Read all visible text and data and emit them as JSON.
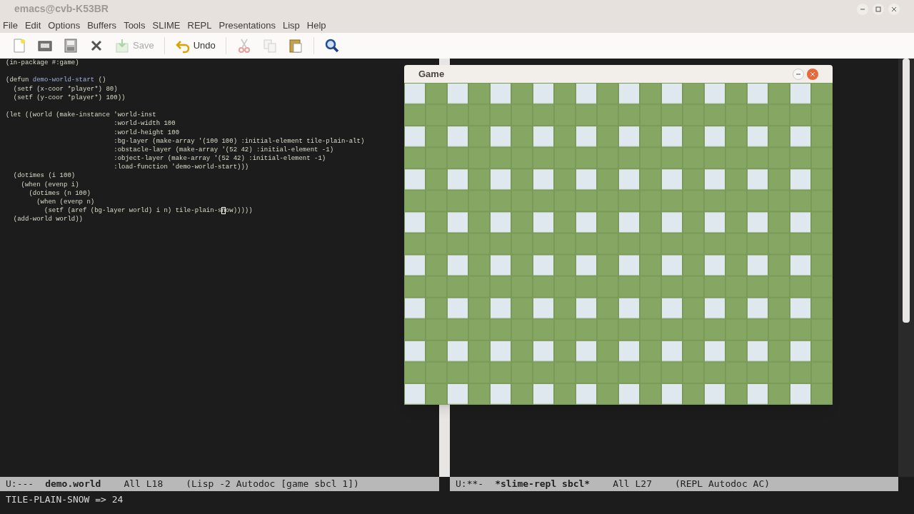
{
  "window": {
    "title": "emacs@cvb-K53BR"
  },
  "menu": [
    "File",
    "Edit",
    "Options",
    "Buffers",
    "Tools",
    "SLIME",
    "REPL",
    "Presentations",
    "Lisp",
    "Help"
  ],
  "toolbar": [
    {
      "kind": "new-file",
      "disabled": false
    },
    {
      "kind": "open-folder",
      "disabled": false
    },
    {
      "kind": "save-disk",
      "disabled": false
    },
    {
      "kind": "close",
      "disabled": false
    },
    {
      "kind": "save",
      "label": "Save",
      "disabled": true
    },
    {
      "kind": "separator"
    },
    {
      "kind": "undo",
      "label": "Undo",
      "disabled": false
    },
    {
      "kind": "separator"
    },
    {
      "kind": "cut",
      "disabled": true
    },
    {
      "kind": "copy",
      "disabled": true
    },
    {
      "kind": "paste",
      "disabled": false
    },
    {
      "kind": "separator"
    },
    {
      "kind": "search",
      "disabled": false
    }
  ],
  "editor": {
    "blocks": [
      [
        [
          {
            "kind": "plain",
            "text": "(in-package #:game)"
          }
        ]
      ],
      [
        [
          {
            "kind": "plain",
            "text": "(defun "
          },
          {
            "kind": "function-name",
            "text": "demo-world-start"
          },
          {
            "kind": "plain",
            "text": " ()"
          }
        ],
        [
          {
            "kind": "plain",
            "text": "  (setf (x-coor *player*) 80)"
          }
        ],
        [
          {
            "kind": "plain",
            "text": "  (setf (y-coor *player*) 100))"
          }
        ]
      ],
      [
        [
          {
            "kind": "plain",
            "text": "(let ((world (make-instance 'world-inst"
          }
        ],
        [
          {
            "kind": "plain",
            "text": "                            :world-width 100"
          }
        ],
        [
          {
            "kind": "plain",
            "text": "                            :world-height 100"
          }
        ],
        [
          {
            "kind": "plain",
            "text": "                            :bg-layer (make-array '(100 100) :initial-element tile-plain-alt)"
          }
        ],
        [
          {
            "kind": "plain",
            "text": "                            :obstacle-layer (make-array '(52 42) :initial-element -1)"
          }
        ],
        [
          {
            "kind": "plain",
            "text": "                            :object-layer (make-array '(52 42) :initial-element -1)"
          }
        ],
        [
          {
            "kind": "plain",
            "text": "                            :load-function 'demo-world-start)))"
          }
        ],
        [
          {
            "kind": "plain",
            "text": "  (dotimes (i 100)"
          }
        ],
        [
          {
            "kind": "plain",
            "text": "    (when (evenp i)"
          }
        ],
        [
          {
            "kind": "plain",
            "text": "      (dotimes (n 100)"
          }
        ],
        [
          {
            "kind": "plain",
            "text": "        (when (evenp n)"
          }
        ],
        [
          {
            "kind": "plain",
            "text": "          (setf (aref (bg-layer world) i n) tile-plain-s"
          },
          {
            "kind": "cursor",
            "text": "n"
          },
          {
            "kind": "plain",
            "text": "ow)))))"
          }
        ],
        [
          {
            "kind": "plain",
            "text": "  (add-world world))"
          }
        ]
      ]
    ]
  },
  "game_window": {
    "title": "Game",
    "kind": "picture"
  },
  "mode_lines": [
    {
      "state": "U:---",
      "buffer": "demo.world",
      "position": "All L18",
      "modes": "(Lisp -2 Autodoc [game sbcl 1])"
    },
    {
      "state": "U:**-",
      "buffer": "*slime-repl sbcl*",
      "position": "All L27",
      "modes": "(REPL Autodoc AC)"
    }
  ],
  "echo_area": "TILE-PLAIN-SNOW => 24"
}
